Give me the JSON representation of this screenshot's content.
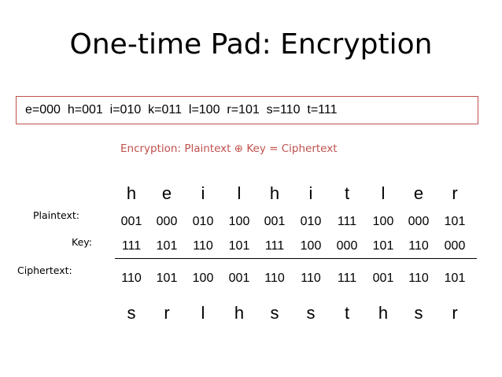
{
  "title": "One-time Pad: Encryption",
  "mapping": "e=000  h=001  i=010  k=011  l=100  r=101  s=110  t=111",
  "formula": {
    "label": "Encryption:",
    "text": "Plaintext ⊕ Key = Ciphertext"
  },
  "labels": {
    "plaintext": "Plaintext:",
    "key": "Key:",
    "ciphertext": "Ciphertext:"
  },
  "plain_letters": [
    "h",
    "e",
    "i",
    "l",
    "h",
    "i",
    "t",
    "l",
    "e",
    "r"
  ],
  "plain_bits": [
    "001",
    "000",
    "010",
    "100",
    "001",
    "010",
    "111",
    "100",
    "000",
    "101"
  ],
  "key_bits": [
    "111",
    "101",
    "110",
    "101",
    "111",
    "100",
    "000",
    "101",
    "110",
    "000"
  ],
  "cipher_bits": [
    "110",
    "101",
    "100",
    "001",
    "110",
    "110",
    "111",
    "001",
    "110",
    "101"
  ],
  "cipher_letters": [
    "s",
    "r",
    "l",
    "h",
    "s",
    "s",
    "t",
    "h",
    "s",
    "r"
  ]
}
